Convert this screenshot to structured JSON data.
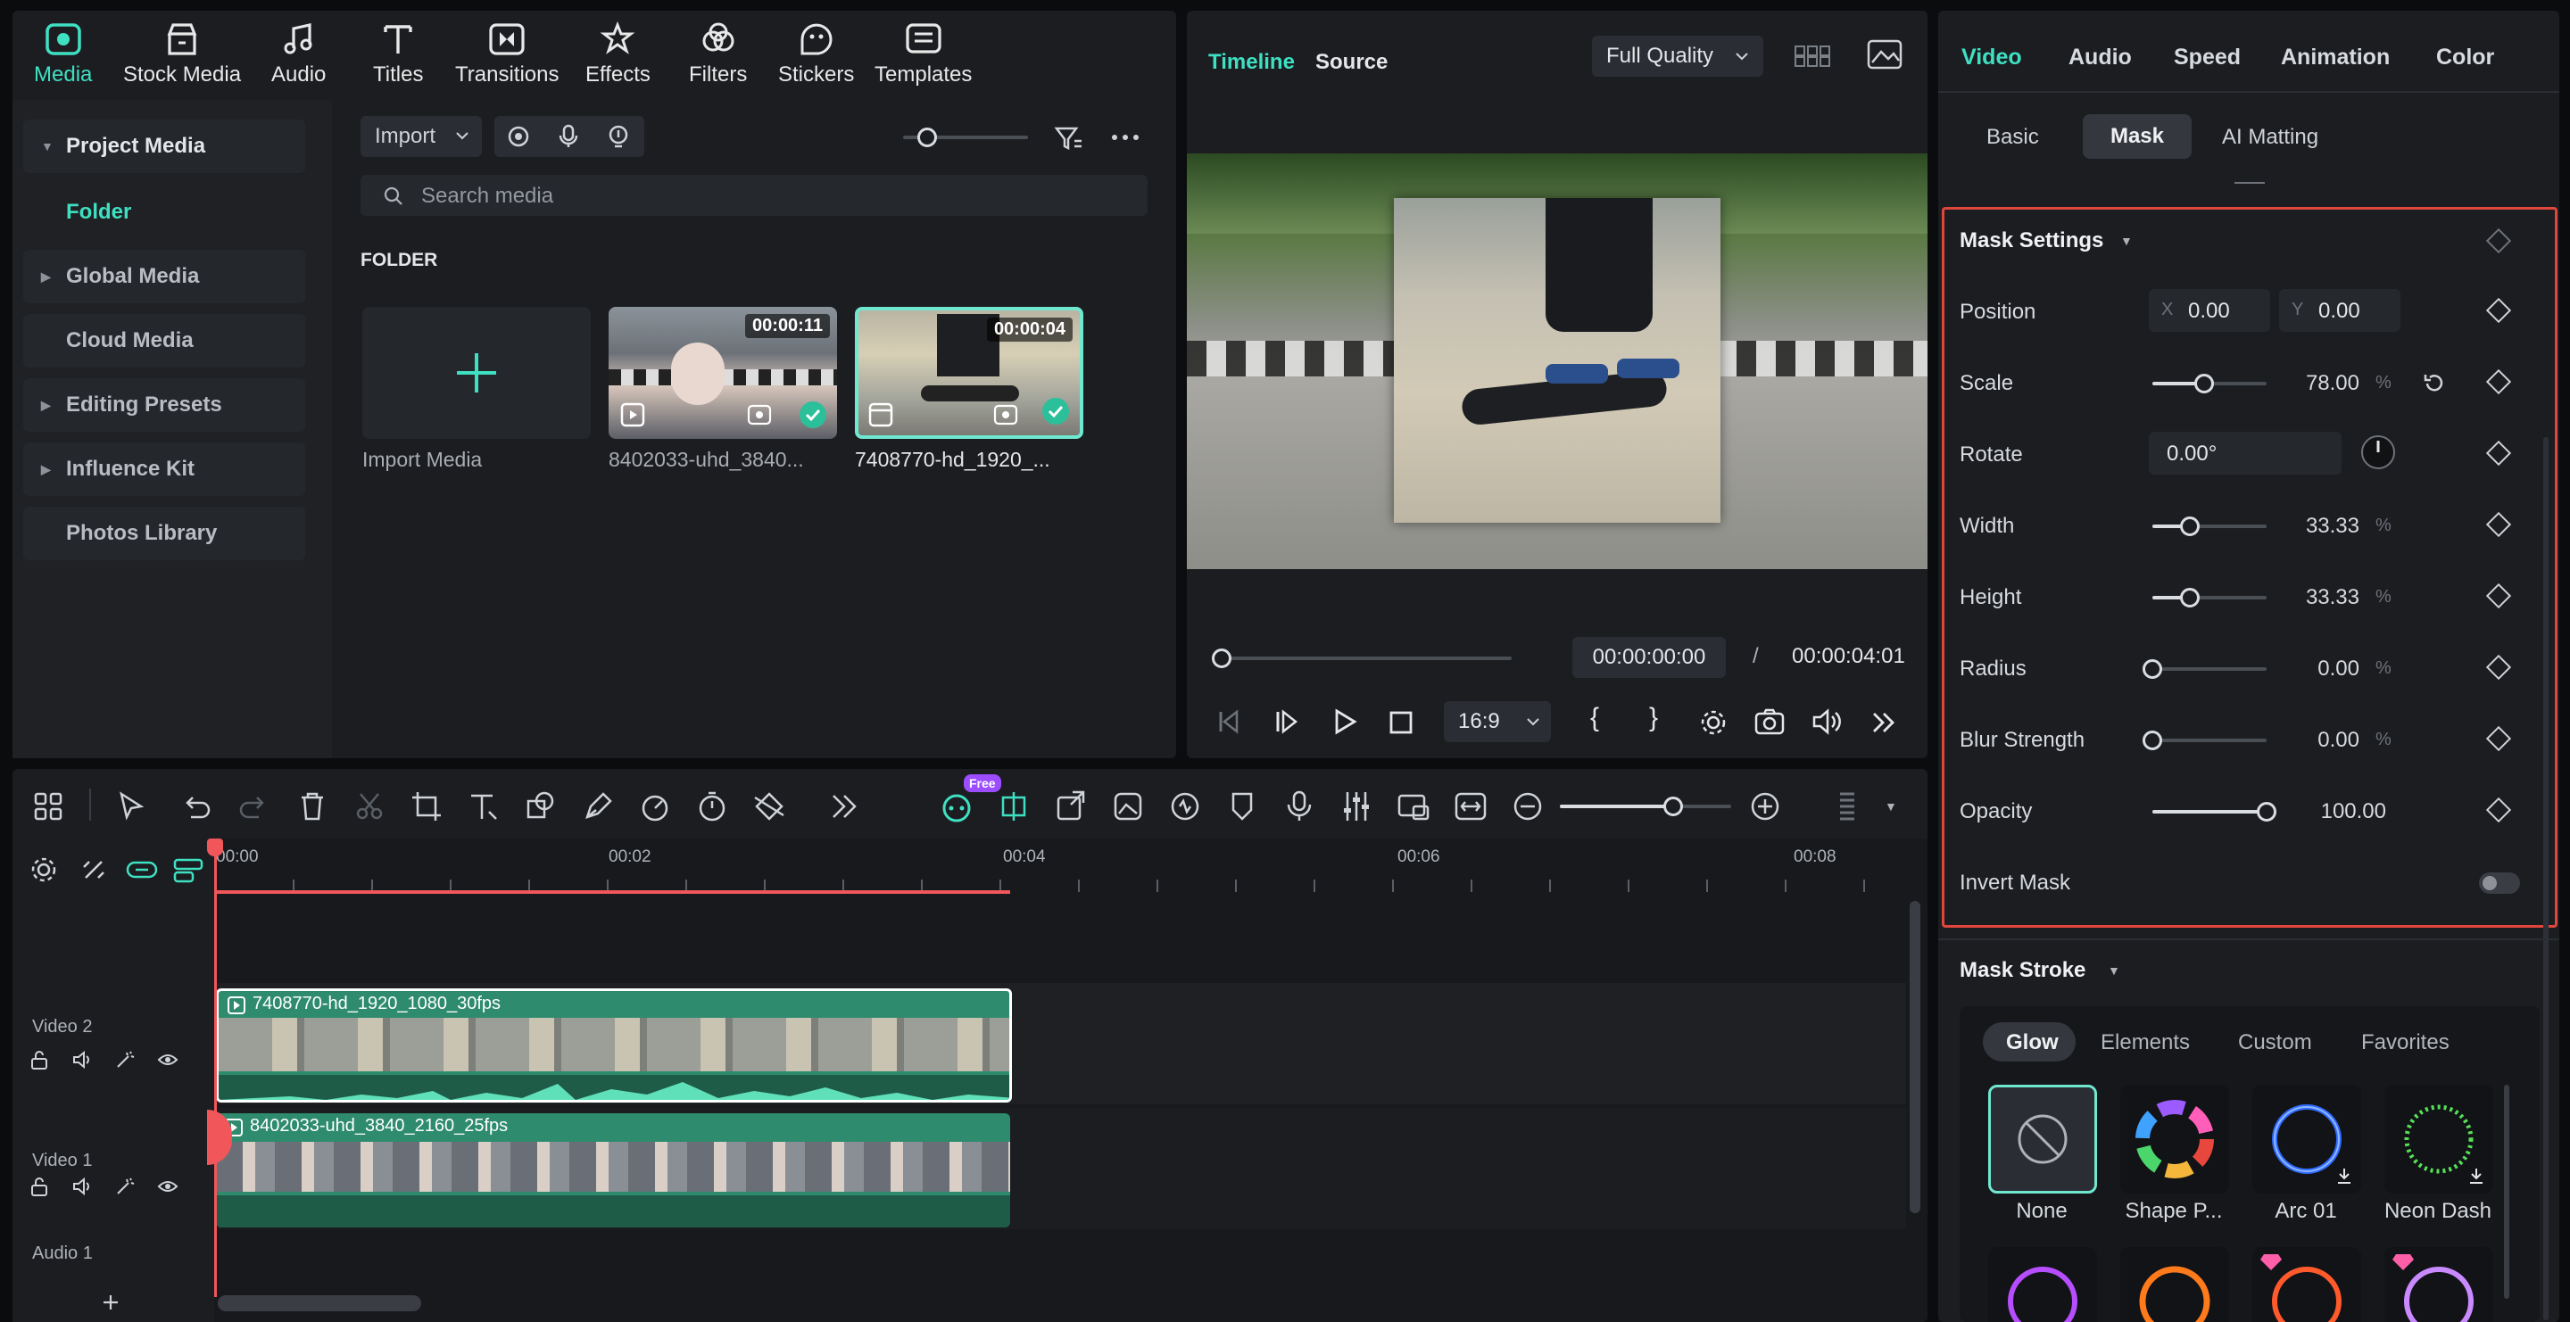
{
  "toolbar": {
    "items": [
      {
        "label": "Media",
        "icon": "media-icon",
        "active": true
      },
      {
        "label": "Stock Media",
        "icon": "stock-media-icon"
      },
      {
        "label": "Audio",
        "icon": "music-note-icon"
      },
      {
        "label": "Titles",
        "icon": "titles-icon"
      },
      {
        "label": "Transitions",
        "icon": "transitions-icon"
      },
      {
        "label": "Effects",
        "icon": "effects-icon"
      },
      {
        "label": "Filters",
        "icon": "filters-icon"
      },
      {
        "label": "Stickers",
        "icon": "stickers-icon"
      },
      {
        "label": "Templates",
        "icon": "templates-icon"
      }
    ]
  },
  "sidebar": {
    "items": [
      {
        "label": "Project Media",
        "expanded": true
      },
      {
        "label": "Folder",
        "active": true
      },
      {
        "label": "Global Media"
      },
      {
        "label": "Cloud Media"
      },
      {
        "label": "Editing Presets"
      },
      {
        "label": "Influence Kit"
      },
      {
        "label": "Photos Library"
      }
    ]
  },
  "media": {
    "import_label": "Import",
    "search_placeholder": "Search media",
    "folder_heading": "FOLDER",
    "import_media_label": "Import Media",
    "clips": [
      {
        "duration": "00:00:11",
        "name": "8402033-uhd_3840..."
      },
      {
        "duration": "00:00:04",
        "name": "7408770-hd_1920_..."
      }
    ]
  },
  "preview": {
    "tab_timeline": "Timeline",
    "tab_source": "Source",
    "quality": "Full Quality",
    "current_time": "00:00:00:00",
    "separator": "/",
    "total_time": "00:00:04:01",
    "aspect": "16:9",
    "progress": 0
  },
  "timeline": {
    "ruler": [
      "00:00",
      "00:02",
      "00:04",
      "00:06",
      "00:08"
    ],
    "free_badge": "Free",
    "tracks": [
      {
        "name": "Video 2",
        "clip": "7408770-hd_1920_1080_30fps"
      },
      {
        "name": "Video 1",
        "clip": "8402033-uhd_3840_2160_25fps"
      },
      {
        "name": "Audio 1"
      }
    ],
    "zoom_level": 0.66
  },
  "properties": {
    "top_tabs": [
      "Video",
      "Audio",
      "Speed",
      "Animation",
      "Color"
    ],
    "sub_tabs": [
      "Basic",
      "Mask",
      "AI Matting"
    ],
    "mask_settings_title": "Mask Settings",
    "position": {
      "label": "Position",
      "x_label": "X",
      "x": "0.00",
      "y_label": "Y",
      "y": "0.00"
    },
    "rotate": {
      "label": "Rotate",
      "value": "0.00°"
    },
    "sliders": [
      {
        "label": "Scale",
        "value": "78.00",
        "unit": "%",
        "fraction": 0.45
      },
      {
        "label": "Width",
        "value": "33.33",
        "unit": "%",
        "fraction": 0.33
      },
      {
        "label": "Height",
        "value": "33.33",
        "unit": "%",
        "fraction": 0.33
      },
      {
        "label": "Radius",
        "value": "0.00",
        "unit": "%",
        "fraction": 0.0
      },
      {
        "label": "Blur Strength",
        "value": "0.00",
        "unit": "%",
        "fraction": 0.0
      },
      {
        "label": "Opacity",
        "value": "100.00",
        "unit": "",
        "fraction": 1.0
      }
    ],
    "invert_mask": "Invert Mask",
    "mask_stroke_title": "Mask Stroke",
    "stroke_tabs": [
      "Glow",
      "Elements",
      "Custom",
      "Favorites"
    ],
    "stroke_presets": [
      "None",
      "Shape P...",
      "Arc 01",
      "Neon Dash"
    ]
  },
  "colors": {
    "accent": "#3fe0c2",
    "clip_green": "#2e8b6e",
    "playhead": "#f0565a",
    "highlight_border": "#e0463c"
  }
}
